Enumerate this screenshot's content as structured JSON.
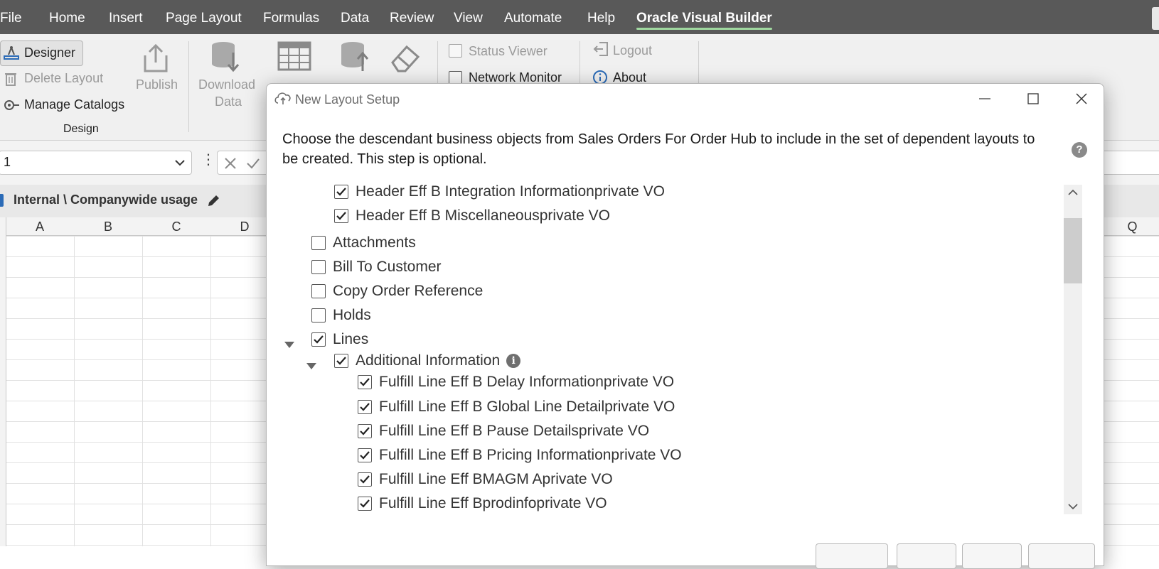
{
  "menubar": {
    "items": [
      "File",
      "Home",
      "Insert",
      "Page Layout",
      "Formulas",
      "Data",
      "Review",
      "View",
      "Automate",
      "Help",
      "Oracle Visual Builder"
    ],
    "active": "Oracle Visual Builder"
  },
  "ribbon": {
    "designer": "Designer",
    "delete_layout": "Delete Layout",
    "manage_catalogs": "Manage Catalogs",
    "publish": "Publish",
    "download_data_l1": "Download",
    "download_data_l2": "Data",
    "group_design": "Design",
    "status_viewer": "Status Viewer",
    "network_monitor": "Network Monitor",
    "logout": "Logout",
    "about": "About"
  },
  "formula_bar": {
    "name_box_value": "1"
  },
  "sheet_tab": {
    "label": "Internal \\ Companywide usage"
  },
  "columns": [
    "A",
    "B",
    "C",
    "D",
    "Q"
  ],
  "dialog": {
    "title": "New Layout Setup",
    "instruction": "Choose the descendant business objects from Sales Orders For Order Hub to include in the set of dependent layouts to be created. This step is optional.",
    "help_glyph": "?",
    "tree": [
      {
        "label": "Header Eff B Integration  Informationprivate VO",
        "checked": true
      },
      {
        "label": "Header Eff B Miscellaneousprivate VO",
        "checked": true
      },
      {
        "label": "Attachments",
        "checked": false
      },
      {
        "label": "Bill To Customer",
        "checked": false
      },
      {
        "label": "Copy Order Reference",
        "checked": false
      },
      {
        "label": "Holds",
        "checked": false
      },
      {
        "label": "Lines",
        "checked": true,
        "expanded": true
      },
      {
        "label": "Additional Information",
        "checked": true,
        "expanded": true
      },
      {
        "label": "Fulfill Line Eff B Delay  Informationprivate VO",
        "checked": true
      },
      {
        "label": "Fulfill Line Eff B Global  Line  Detailprivate VO",
        "checked": true
      },
      {
        "label": "Fulfill Line Eff B Pause Detailsprivate VO",
        "checked": true
      },
      {
        "label": "Fulfill Line Eff B Pricing  Informationprivate VO",
        "checked": true
      },
      {
        "label": "Fulfill Line Eff BMAGM Aprivate VO",
        "checked": true
      },
      {
        "label": "Fulfill Line Eff Bprodinfoprivate VO",
        "checked": true
      }
    ],
    "info_glyph": "i"
  }
}
